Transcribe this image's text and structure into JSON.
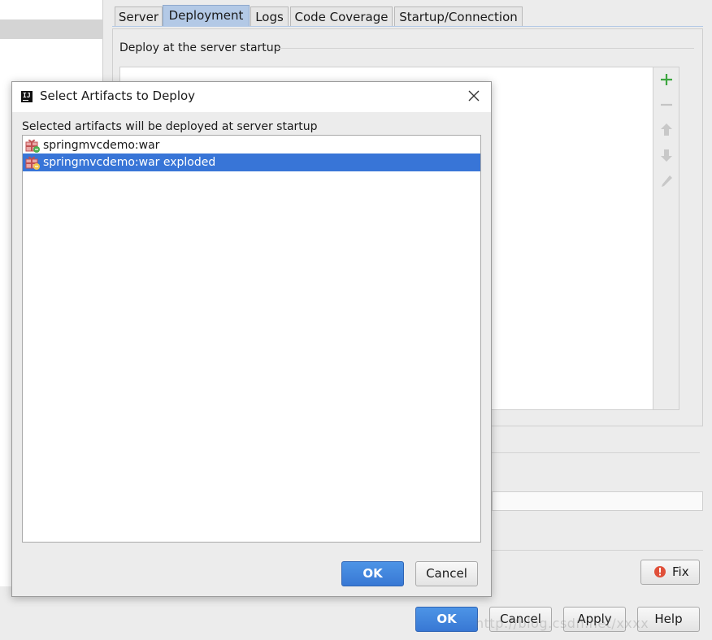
{
  "tabs": [
    {
      "label": "Server",
      "active": false
    },
    {
      "label": "Deployment",
      "active": true
    },
    {
      "label": "Logs",
      "active": false
    },
    {
      "label": "Code Coverage",
      "active": false
    },
    {
      "label": "Startup/Connection",
      "active": false
    }
  ],
  "deployment": {
    "section_title": "Deploy at the server startup",
    "toolbar": [
      "add-icon",
      "remove-icon",
      "move-up-icon",
      "move-down-icon",
      "edit-icon"
    ]
  },
  "fix_button": {
    "label": "Fix",
    "icon": "error-icon"
  },
  "footer": {
    "ok": "OK",
    "cancel": "Cancel",
    "apply": "Apply",
    "help": "Help"
  },
  "watermark": "http://blog.csdn.net/xxxx",
  "dialog": {
    "title": "Select Artifacts to Deploy",
    "description": "Selected artifacts will be deployed at server startup",
    "artifacts": [
      {
        "name": "springmvcdemo:war",
        "selected": false,
        "icon": "artifact-icon"
      },
      {
        "name": "springmvcdemo:war exploded",
        "selected": true,
        "icon": "artifact-icon"
      }
    ],
    "ok": "OK",
    "cancel": "Cancel"
  },
  "colors": {
    "accent": "#3875d7",
    "tab_active": "#b3c9e6",
    "primary_button": "#3878d4",
    "add_green": "#3da640"
  }
}
